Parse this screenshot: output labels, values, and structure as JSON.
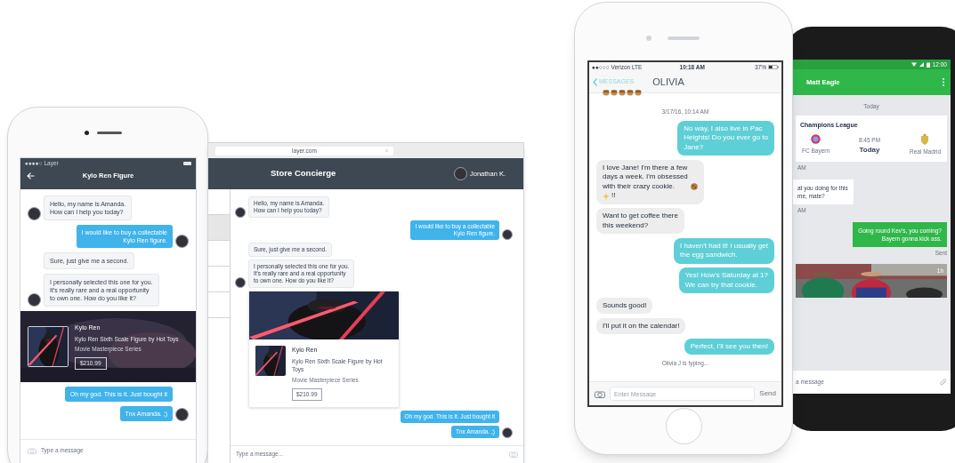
{
  "left_phone": {
    "carrier": "●●●●○ Layer",
    "title": "Kylo Ren Figure",
    "messages": [
      {
        "kind": "text",
        "outgoing": false,
        "avatar": true,
        "text": "Hello, my name is Amanda.\nHow can I help you today?"
      },
      {
        "kind": "text",
        "outgoing": true,
        "avatar": true,
        "text": "I would like to buy a collectable\nKylo Ren figure."
      },
      {
        "kind": "text",
        "outgoing": false,
        "avatar": false,
        "text": "Sure, just give me a second."
      },
      {
        "kind": "text",
        "outgoing": false,
        "avatar": true,
        "text": "I personally selected this one for you.\nIt's really rare and a real opportunity\nto own one. How do you like it?"
      },
      {
        "kind": "product",
        "name": "Kylo Ren",
        "description": "Kylo Ren Sixth Scale Figure by Hot Toys",
        "series": "Movie Masterpiece Series",
        "price": "$210.99"
      },
      {
        "kind": "text",
        "outgoing": true,
        "avatar": false,
        "text": "Oh my god. This is it. Just bought it"
      },
      {
        "kind": "text",
        "outgoing": true,
        "avatar": true,
        "text": "Tnx Amanda. ;)"
      }
    ],
    "composer": {
      "placeholder": "Type a message"
    }
  },
  "browser": {
    "url": "layer.com",
    "title": "Store Concierge",
    "user": "Jonathan K.",
    "sidebar_rows": [
      {
        "selected": false
      },
      {
        "selected": true
      },
      {
        "selected": false
      },
      {
        "selected": false
      },
      {
        "selected": false
      }
    ],
    "messages": [
      {
        "kind": "text",
        "outgoing": false,
        "avatar": true,
        "text": "Hello, my name is Amanda.\nHow can I help you today?"
      },
      {
        "kind": "text",
        "outgoing": true,
        "avatar": true,
        "text": "I would like to buy a collectable\nKylo Ren figure."
      },
      {
        "kind": "text",
        "outgoing": false,
        "avatar": false,
        "text": "Sure, just give me a second."
      },
      {
        "kind": "text",
        "outgoing": false,
        "avatar": true,
        "text": "I personally selected this one for you.\nIt's really rare and a real opportunity\nto own one. How do you like it?"
      },
      {
        "kind": "product",
        "name": "Kylo Ren",
        "description": "Kylo Ren Sixth Scale Figure by Hot Toys",
        "series": "Movie Masterpiece Series",
        "price": "$210.99"
      },
      {
        "kind": "text",
        "outgoing": true,
        "avatar": false,
        "text": "Oh my god. This is it. Just bought it"
      },
      {
        "kind": "text",
        "outgoing": true,
        "avatar": true,
        "text": "Tnx Amanda. ;)"
      }
    ],
    "composer": {
      "placeholder": "Type a message..."
    }
  },
  "iphone": {
    "status": {
      "carrier": "●●○○○ Verizon LTE",
      "time": "10:18 AM",
      "battery": "37%"
    },
    "back": "MESSAGES",
    "title": "OLIVIA",
    "timestamp": "3/17/16, 10:14 AM",
    "messages": [
      {
        "kind": "text",
        "outgoing": true,
        "text": "No way, I also live in Pac\nHeights! Do you ever go to\nJane?"
      },
      {
        "kind": "emoji_text",
        "outgoing": false,
        "text": "I love Jane! I'm there a few\ndays a week. I'm obsessed\nwith their crazy cookie.",
        "text_after": "!!"
      },
      {
        "kind": "text",
        "outgoing": false,
        "text": "Want to get coffee there\nthis weekend?"
      },
      {
        "kind": "text",
        "outgoing": true,
        "text": "I haven't had it! I usually get\nthe egg sandwich."
      },
      {
        "kind": "text",
        "outgoing": true,
        "text": "Yes! How's Saturday at 1?\nWe can try that cookie."
      },
      {
        "kind": "text",
        "outgoing": false,
        "text": "Sounds good!"
      },
      {
        "kind": "text",
        "outgoing": false,
        "text": "I'll put it on the calendar!"
      },
      {
        "kind": "text",
        "outgoing": true,
        "text": "Perfect, I'll see you then!"
      }
    ],
    "typing": "Olivia J is typing...",
    "composer": {
      "placeholder": "Enter Message",
      "send": "Send"
    }
  },
  "android": {
    "status": {
      "time": "12:00"
    },
    "title": "Matt Eagle",
    "day": "Today",
    "items": [
      {
        "kind": "match",
        "title": "Champions League",
        "home": "FC Bayern",
        "time": "8:45 PM",
        "day": "Today",
        "away": "Real Madrid",
        "meta": "AM"
      },
      {
        "kind": "text",
        "outgoing": false,
        "text": "at you doing for this\nme, mate?",
        "meta": "AM"
      },
      {
        "kind": "text",
        "outgoing": true,
        "text": "Going round Kev's, you coming?\nBayern gonna kick ass.",
        "meta": "Sent"
      },
      {
        "meta": "1h"
      }
    ],
    "composer": {
      "placeholder": "a message"
    }
  }
}
